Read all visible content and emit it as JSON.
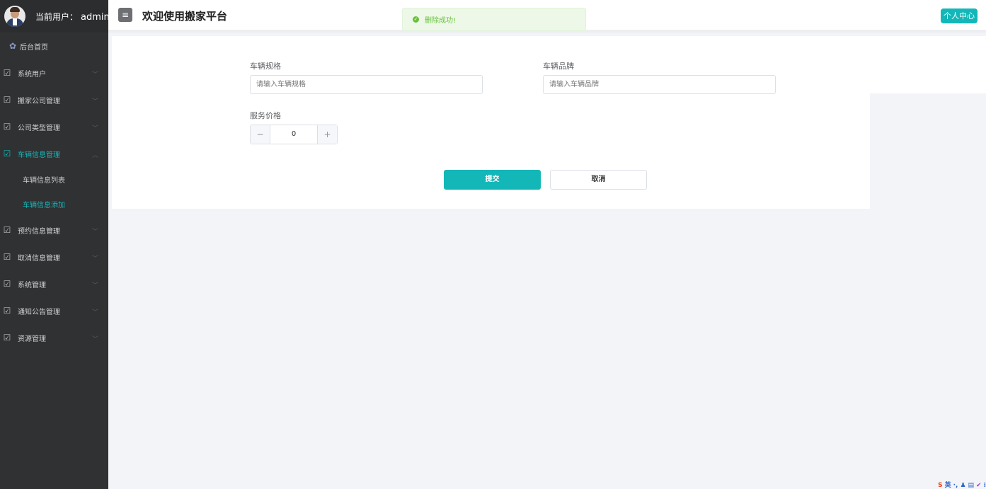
{
  "sidebar": {
    "user_label": "当前用户：",
    "user_name": "admin",
    "home": "后台首页",
    "items": [
      {
        "label": "系统用户"
      },
      {
        "label": "搬家公司管理"
      },
      {
        "label": "公司类型管理"
      },
      {
        "label": "车辆信息管理"
      },
      {
        "label": "预约信息管理"
      },
      {
        "label": "取消信息管理"
      },
      {
        "label": "系统管理"
      },
      {
        "label": "通知公告管理"
      },
      {
        "label": "资源管理"
      }
    ],
    "sub_items": [
      "车辆信息列表",
      "车辆信息添加"
    ]
  },
  "header": {
    "toggle_icon": "≡",
    "title": "欢迎使用搬家平台",
    "profile_button": "个人中心"
  },
  "toast": {
    "message": "删除成功!",
    "color": "#67c23a"
  },
  "form": {
    "spec_label": "车辆规格",
    "spec_placeholder": "请输入车辆规格",
    "brand_label": "车辆品牌",
    "brand_placeholder": "请输入车辆品牌",
    "price_label": "服务价格",
    "price_value": "0",
    "minus": "−",
    "plus": "+",
    "submit": "提交",
    "cancel": "取消"
  },
  "colors": {
    "accent": "#14b7b8",
    "sidebar_bg": "#2f3133"
  },
  "tray": {
    "logo": "S",
    "text": "英"
  }
}
